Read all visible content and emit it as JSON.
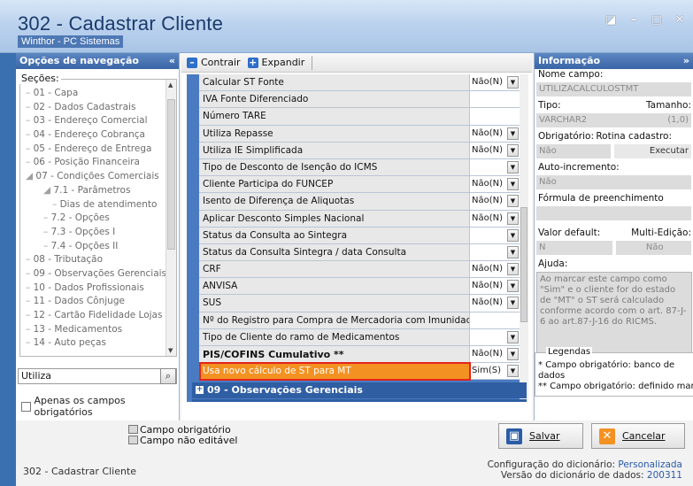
{
  "window": {
    "title": "302 - Cadastrar Cliente",
    "subtitle": "Winthor - PC Sistemas",
    "controls": [
      "◪",
      "–",
      "□",
      "✕"
    ]
  },
  "left_panel": {
    "header": "Opções de navegação",
    "collapse_glyph": "«",
    "sections_label": "Seções:",
    "tree": [
      {
        "label": "01 - Capa",
        "level": 0
      },
      {
        "label": "02 - Dados Cadastrais",
        "level": 0
      },
      {
        "label": "03 - Endereço Comercial",
        "level": 0
      },
      {
        "label": "04 - Endereço Cobrança",
        "level": 0
      },
      {
        "label": "05 - Endereço de Entrega",
        "level": 0
      },
      {
        "label": "06 - Posição Financeira",
        "level": 0
      },
      {
        "label": "07 - Condições Comerciais",
        "level": 0,
        "expanded": true
      },
      {
        "label": "7.1 - Parâmetros",
        "level": 1,
        "expanded": true
      },
      {
        "label": "Dias de atendimento",
        "level": 2
      },
      {
        "label": "7.2 - Opções",
        "level": 1
      },
      {
        "label": "7.3 - Opções I",
        "level": 1
      },
      {
        "label": "7.4 - Opções II",
        "level": 1
      },
      {
        "label": "08 - Tributação",
        "level": 0
      },
      {
        "label": "09 - Observações Gerenciais",
        "level": 0
      },
      {
        "label": "10 - Dados Profissionais",
        "level": 0
      },
      {
        "label": "11 - Dados Cônjuge",
        "level": 0
      },
      {
        "label": "12 - Cartão Fidelidade Lojas",
        "level": 0
      },
      {
        "label": "13 - Medicamentos",
        "level": 0
      },
      {
        "label": "14 - Auto peças",
        "level": 0
      }
    ],
    "search_value": "Utiliza",
    "only_required_label": "Apenas os campos obrigatórios"
  },
  "center_panel": {
    "toolbar": {
      "collapse_label": "Contrair",
      "expand_label": "Expandir"
    },
    "rows": [
      {
        "label": "Calcular ST Fonte",
        "value": "Não(N)",
        "dropdown": true
      },
      {
        "label": "IVA Fonte Diferenciado",
        "value": "",
        "dropdown": false
      },
      {
        "label": "Número TARE",
        "value": "",
        "dropdown": false
      },
      {
        "label": "Utiliza Repasse",
        "value": "Não(N)",
        "dropdown": true
      },
      {
        "label": "Utiliza IE Simplificada",
        "value": "Não(N)",
        "dropdown": true
      },
      {
        "label": "Tipo de Desconto de Isenção do ICMS",
        "value": "",
        "dropdown": true
      },
      {
        "label": "Cliente Participa do FUNCEP",
        "value": "Não(N)",
        "dropdown": true
      },
      {
        "label": "Isento de Diferença de Aliquotas",
        "value": "Não(N)",
        "dropdown": true
      },
      {
        "label": "Aplicar Desconto Simples Nacional",
        "value": "Não(N)",
        "dropdown": true
      },
      {
        "label": "Status da Consulta ao Sintegra",
        "value": "",
        "dropdown": true
      },
      {
        "label": "Status da Consulta Sintegra / data Consulta",
        "value": "",
        "dropdown": true
      },
      {
        "label": "CRF",
        "value": "Não(N)",
        "dropdown": true
      },
      {
        "label": "ANVISA",
        "value": "Não(N)",
        "dropdown": true
      },
      {
        "label": "SUS",
        "value": "Não(N)",
        "dropdown": true
      },
      {
        "label": "Nº do Registro para Compra de Mercadoria com Imunidade Tr",
        "value": "",
        "dropdown": false
      },
      {
        "label": "Tipo de Cliente do ramo de Medicamentos",
        "value": "",
        "dropdown": true
      },
      {
        "label": "PIS/COFINS Cumulativo **",
        "value": "Não(N)",
        "dropdown": true,
        "bold": true
      },
      {
        "label": "Usa novo cálculo de ST para MT",
        "value": "Sim(S)",
        "dropdown": true,
        "highlighted": true
      }
    ],
    "sections": [
      {
        "label": "09 - Observações Gerenciais"
      },
      {
        "label": "10 - Dados Profissionais"
      }
    ]
  },
  "right_panel": {
    "header": "Informação",
    "header_glyph": "»",
    "field_name_label": "Nome campo:",
    "field_name": "UTILIZACALCULOSTMT",
    "type_label": "Tipo:",
    "size_label": "Tamanho:",
    "type_value": "VARCHAR2",
    "size_value": "(1,0)",
    "required_label": "Obrigatório:",
    "routine_label": "Rotina cadastro:",
    "required_value": "Não",
    "routine_value": "Executar",
    "autoinc_label": "Auto-incremento:",
    "autoinc_value": "Não",
    "formula_label": "Fórmula de preenchimento",
    "formula_value": "",
    "default_label": "Valor default:",
    "multi_label": "Multi-Edição:",
    "default_value": "N",
    "multi_value": "Não",
    "help_label": "Ajuda:",
    "help_text": "Ao marcar este campo como \"Sim\" e o cliente for do estado de \"MT\" o ST será calculado conforme acordo com o art. 87-J-6 ao art.87-J-16 do RICMS.",
    "legend_title": "Legendas",
    "legend_1": "* Campo obrigatório: banco de dados",
    "legend_2": "** Campo obrigatório: definido manua"
  },
  "bottom": {
    "legend_required": "Campo obrigatório",
    "legend_noneditable": "Campo não editável",
    "save_label": "Salvar",
    "cancel_label": "Cancelar",
    "status_left": "302 - Cadastrar Cliente",
    "dict_config_label": "Configuração do dicionário:",
    "dict_config_value": "Personalizada",
    "dict_version_label": "Versão do dicionário de dados:",
    "dict_version_value": "200311"
  },
  "colors": {
    "accent": "#2f5ea3",
    "highlight": "#f39222",
    "highlight_border": "#e3231b"
  }
}
